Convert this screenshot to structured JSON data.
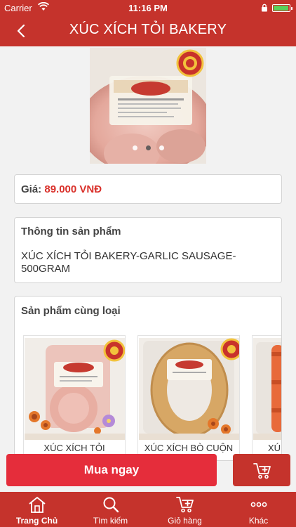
{
  "status_bar": {
    "carrier": "Carrier",
    "time": "11:16 PM",
    "battery_level": 0.95
  },
  "nav": {
    "title": "XÚC XÍCH TỎI BAKERY",
    "back_icon": "chevron-left-icon"
  },
  "gallery": {
    "image_count": 3,
    "active_index": 1
  },
  "price": {
    "label": "Giá:",
    "value": "89.000 VNĐ"
  },
  "product_info": {
    "heading": "Thông tin sản phẩm",
    "description": "XÚC XÍCH TỎI BAKERY-GARLIC SAUSAGE-500GRAM"
  },
  "related": {
    "heading": "Sản phẩm cùng loại",
    "items": [
      {
        "name": "XÚC XÍCH TỎI"
      },
      {
        "name": "XÚC XÍCH BÒ CUỘN"
      },
      {
        "name": "XÚ"
      }
    ]
  },
  "actions": {
    "buy_now": "Mua ngay",
    "cart_icon": "add-to-cart-icon"
  },
  "tabs": [
    {
      "label": "Trang Chủ",
      "icon": "home-icon",
      "active": true
    },
    {
      "label": "Tìm kiếm",
      "icon": "search-icon",
      "active": false
    },
    {
      "label": "Giỏ hàng",
      "icon": "cart-icon",
      "active": false
    },
    {
      "label": "Khác",
      "icon": "more-icon",
      "active": false
    }
  ],
  "colors": {
    "brand": "#c5332c",
    "buy_button": "#e52d3b",
    "price": "#d9302a"
  }
}
